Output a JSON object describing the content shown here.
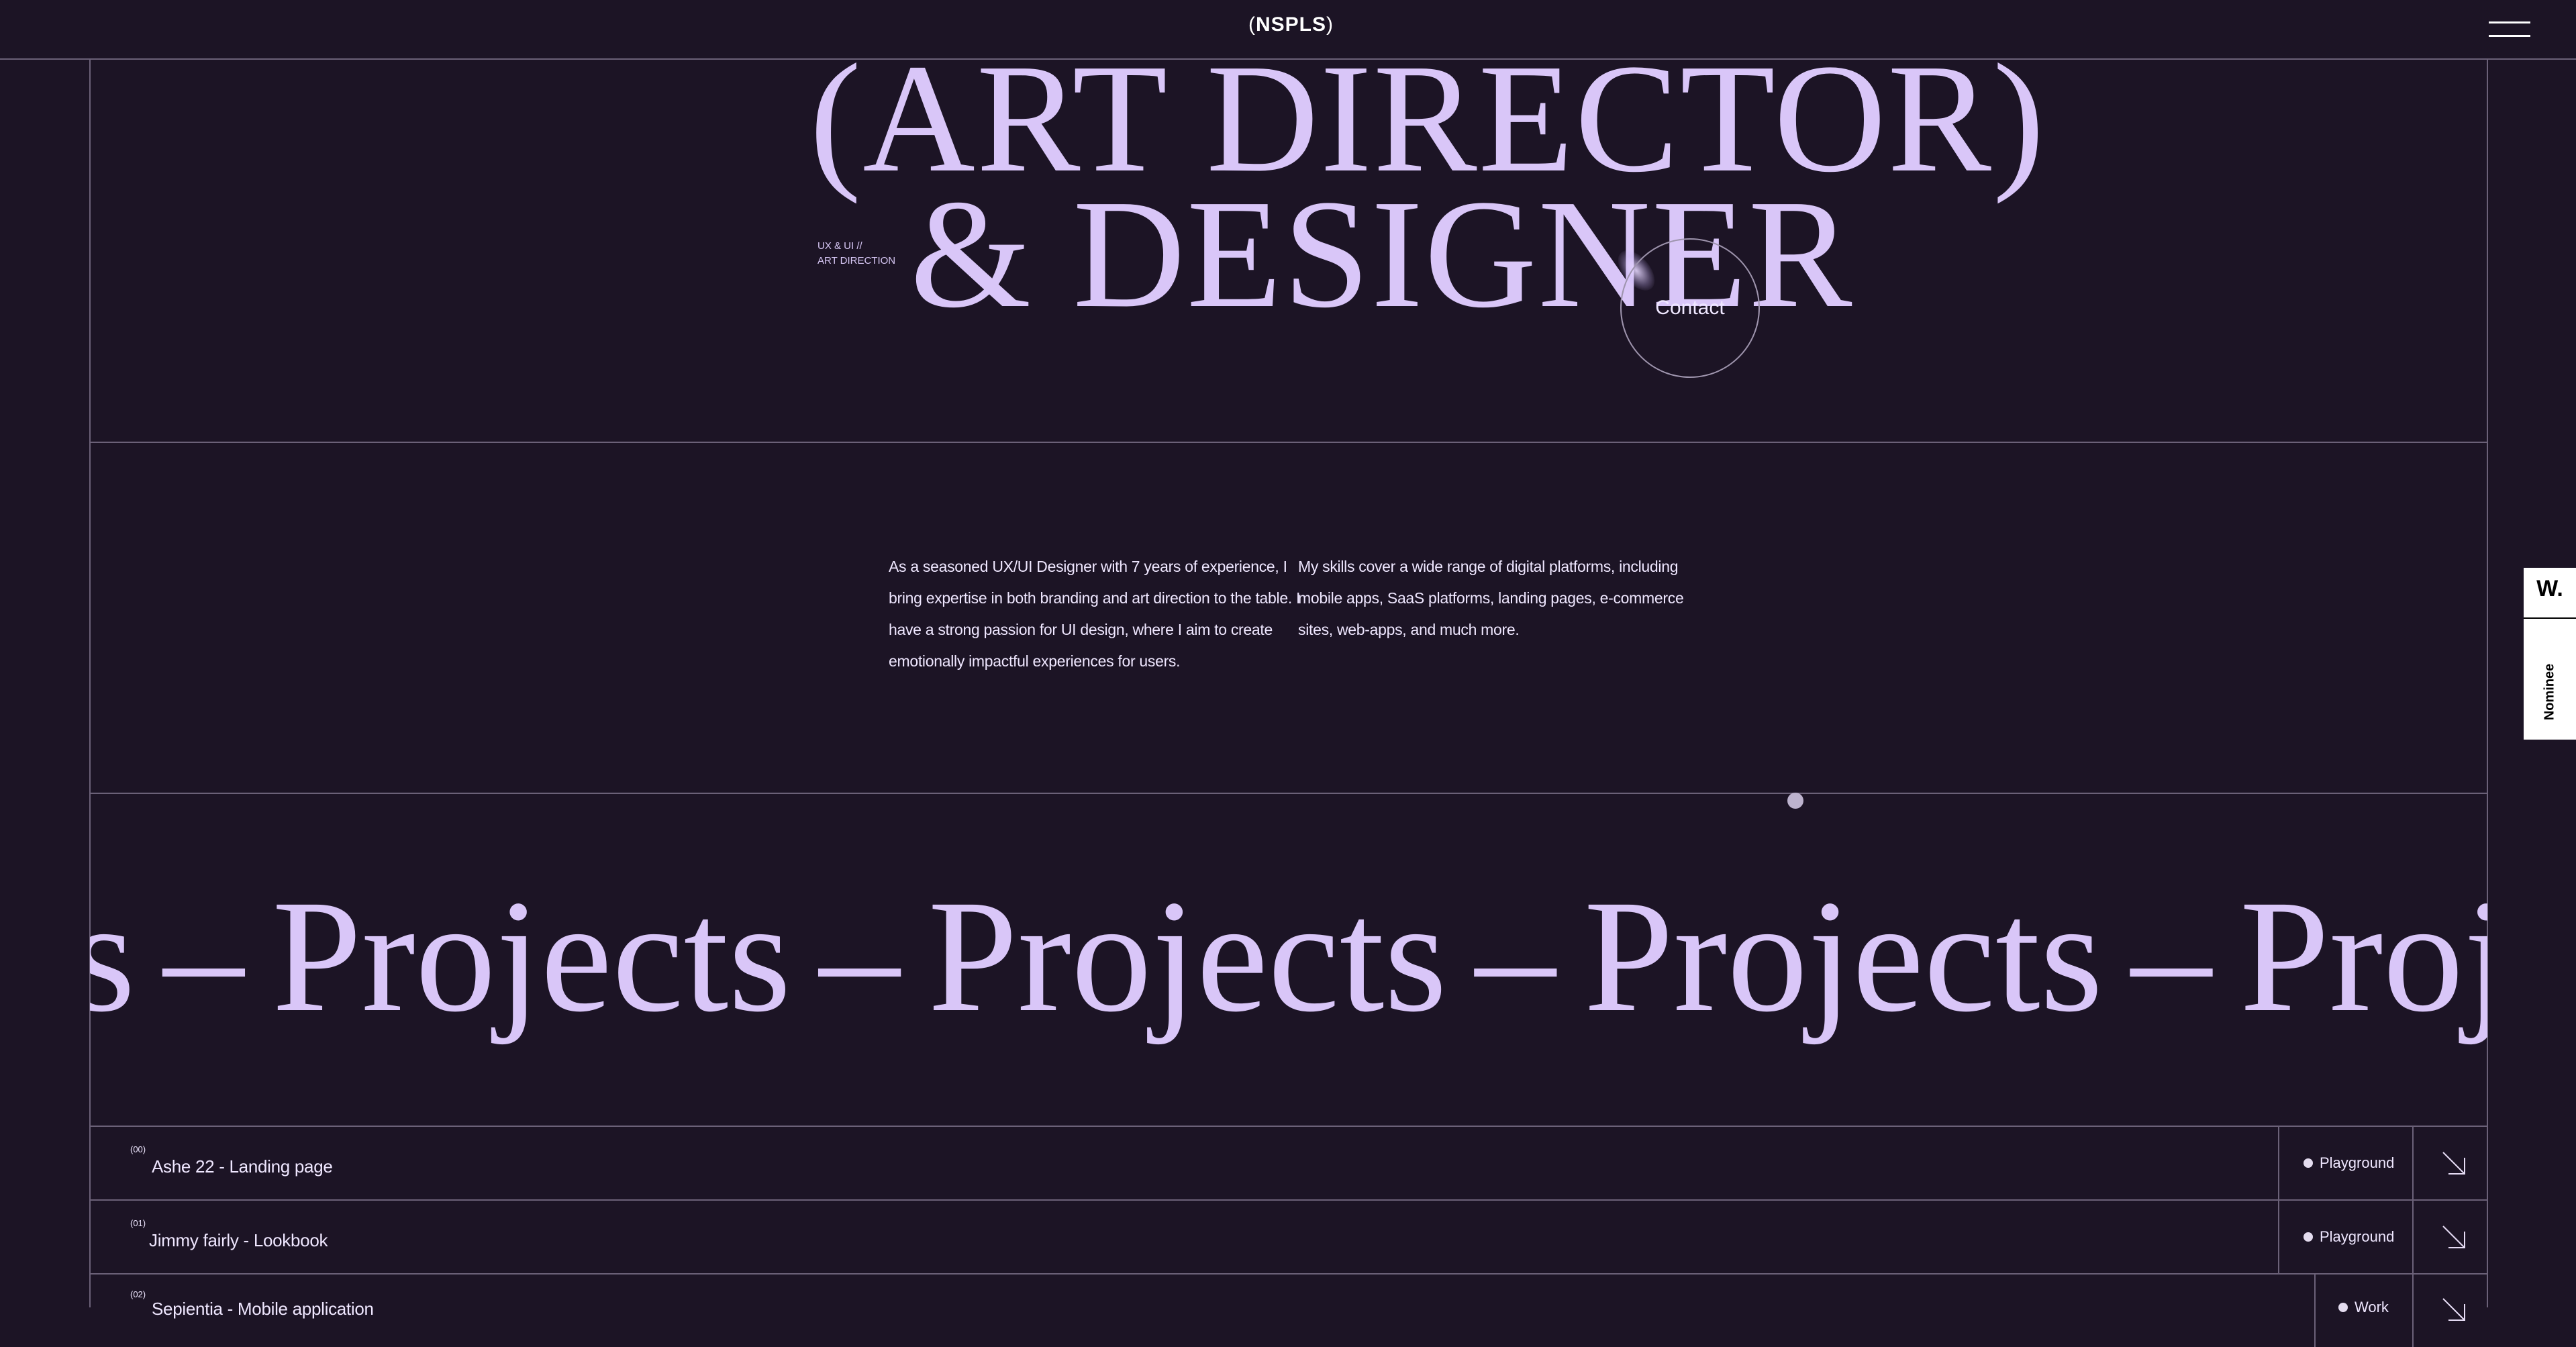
{
  "header": {
    "logo_text": "NSPLS",
    "logo_open": "(",
    "logo_close": ")",
    "menu_icon": "hamburger-icon"
  },
  "hero": {
    "line1": "(ART DIRECTOR)",
    "line2": "& DESIGNER",
    "tag_line1": "UX & UI //",
    "tag_line2": "ART DIRECTION",
    "contact_label": "Contact"
  },
  "about": {
    "col1_lines": [
      "As a seasoned UX/UI Designer with 7 years of experience, I",
      "bring expertise in both branding and art direction to the table. I",
      "have a strong passion for UI design, where I aim to create",
      "emotionally impactful experiences for users."
    ],
    "col2_lines": [
      "My skills cover a wide range of digital platforms, including",
      "mobile apps, SaaS platforms, landing pages, e-commerce",
      "sites, web-apps, and much more."
    ]
  },
  "marquee": {
    "word": "Projects",
    "separator": "–"
  },
  "projects": [
    {
      "num": "(00)",
      "title": "Ashe 22 - Landing page",
      "tag": "Playground",
      "arrow_icon": "arrow-down-right-icon"
    },
    {
      "num": "(01)",
      "title": "Jimmy fairly - Lookbook",
      "tag": "Playground",
      "arrow_icon": "arrow-down-right-icon"
    },
    {
      "num": "(02)",
      "title": "Sepientia - Mobile application",
      "tag": "Work",
      "arrow_icon": "arrow-down-right-icon"
    }
  ],
  "award": {
    "letter": "W.",
    "label": "Nominee"
  },
  "colors": {
    "background": "#1c1425",
    "accent_lavender": "#d9c6f8",
    "line": "#6b6178"
  }
}
